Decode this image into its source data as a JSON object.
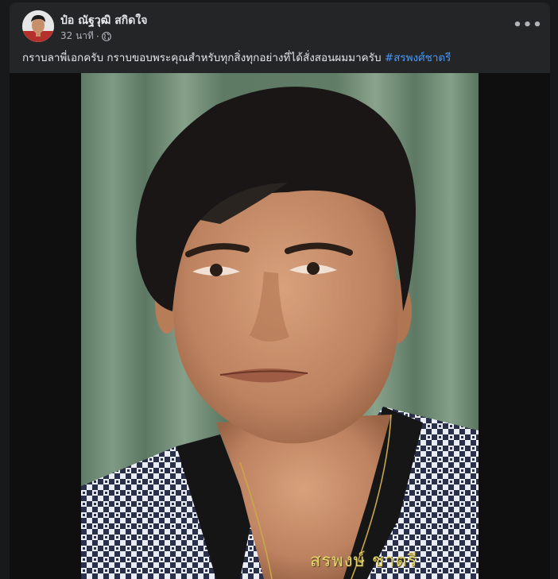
{
  "post": {
    "author": "ป๋อ ณัฐวุฒิ สกิดใจ",
    "time": "32 นาที",
    "separator": "·",
    "privacy_icon": "globe-icon",
    "more_icon": "more-options-icon",
    "more_label": "•••",
    "text": "กราบลาพี่เอกครับ กราบขอบพระคุณสำหรับทุกสิ่งทุกอย่างที่ได้สั่งสอนผมมาครับ ",
    "hashtag": "#สรพงศ์ชาตรี"
  },
  "photo": {
    "caption": "สรพงษ์ ชาตรี"
  },
  "colors": {
    "card_bg": "#242526",
    "page_bg": "#18191a",
    "text_primary": "#e4e6eb",
    "text_secondary": "#b0b3b8",
    "hashtag": "#4599ff",
    "caption": "#e3d56a"
  }
}
